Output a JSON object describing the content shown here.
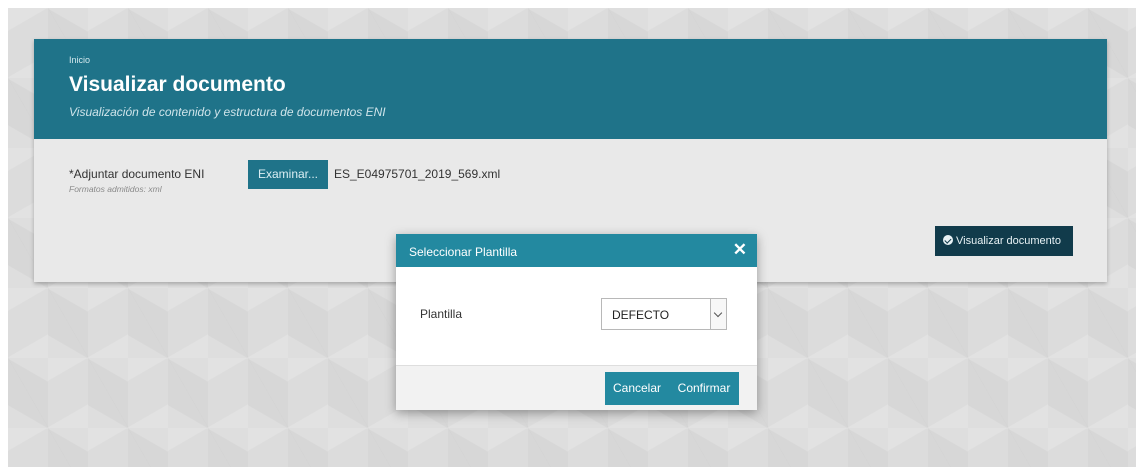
{
  "header": {
    "breadcrumb": "Inicio",
    "title": "Visualizar documento",
    "subtitle": "Visualización de contenido y estructura de documentos ENI"
  },
  "form": {
    "file_label": "*Adjuntar documento ENI",
    "file_hint": "Formatos admitidos: xml",
    "browse_label": "Examinar...",
    "file_name": "ES_E04975701_2019_569.xml",
    "view_button_label": "Visualizar documento",
    "view_button_icon": "check-circle-icon"
  },
  "modal": {
    "title": "Seleccionar Plantilla",
    "close_icon": "close-icon",
    "template_label": "Plantilla",
    "template_selected": "DEFECTO",
    "cancel_label": "Cancelar",
    "confirm_label": "Confirmar"
  },
  "colors": {
    "header_bg": "#1f7389",
    "modal_header_bg": "#2389a0",
    "primary_button_bg": "#113b4b"
  }
}
